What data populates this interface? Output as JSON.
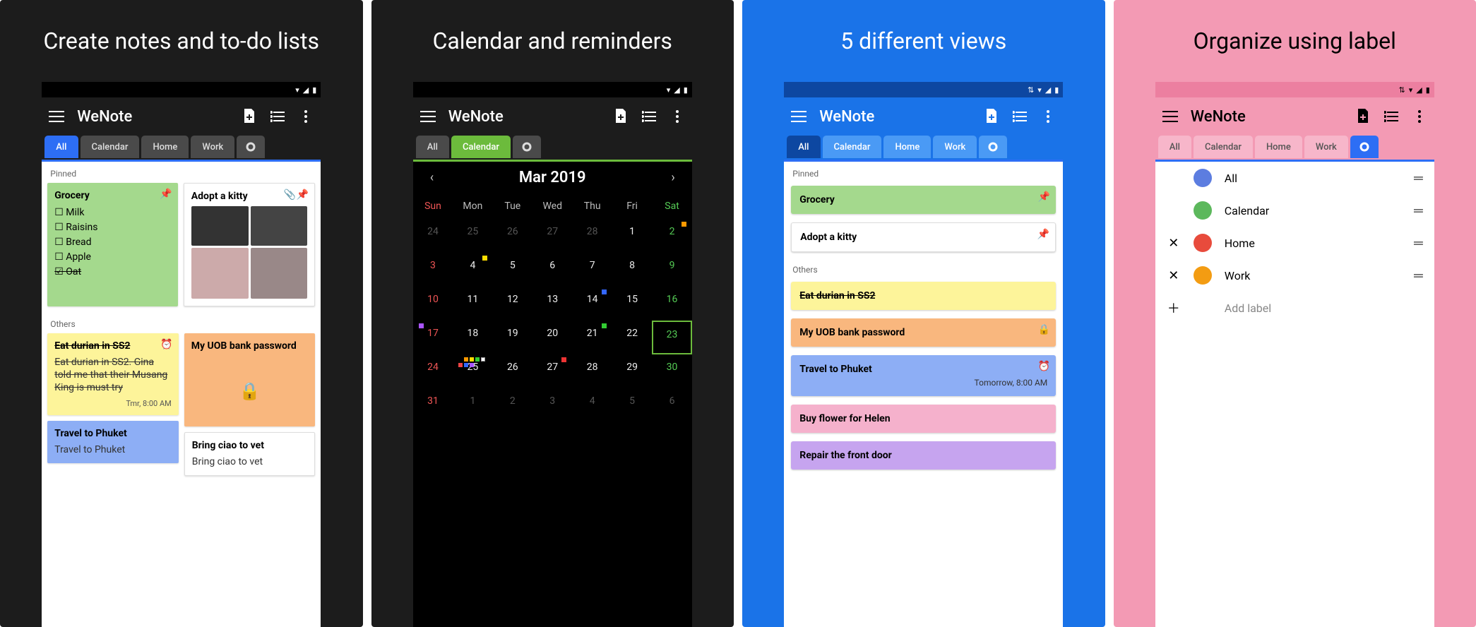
{
  "captions": {
    "p1": "Create notes and to-do lists",
    "p2": "Calendar and reminders",
    "p3": "5 different views",
    "p4": "Organize using label"
  },
  "app": {
    "title": "WeNote"
  },
  "tabs": {
    "all": "All",
    "calendar": "Calendar",
    "home": "Home",
    "work": "Work"
  },
  "sections": {
    "pinned": "Pinned",
    "others": "Others"
  },
  "notes": {
    "grocery": {
      "title": "Grocery",
      "items": [
        "Milk",
        "Raisins",
        "Bread",
        "Apple",
        "Oat"
      ]
    },
    "adopt": {
      "title": "Adopt a kitty"
    },
    "durian": {
      "title": "Eat durian in SS2",
      "body": "Eat durian in SS2. Gina told me that their Musang King is must try",
      "footer": "Tmr, 8:00 AM"
    },
    "uob": {
      "title": "My UOB bank password"
    },
    "phuket": {
      "title": "Travel to Phuket",
      "body": "Travel to Phuket",
      "footer": "Tomorrow, 8:00 AM"
    },
    "ciao": {
      "title": "Bring ciao to vet",
      "body": "Bring ciao to vet"
    },
    "helen": {
      "title": "Buy flower for Helen"
    },
    "repair": {
      "title": "Repair the front door"
    }
  },
  "calendar": {
    "title": "Mar 2019",
    "dow": [
      "Sun",
      "Mon",
      "Tue",
      "Wed",
      "Thu",
      "Fri",
      "Sat"
    ]
  },
  "labels": {
    "all": "All",
    "calendar": "Calendar",
    "home": "Home",
    "work": "Work",
    "add": "Add label"
  }
}
